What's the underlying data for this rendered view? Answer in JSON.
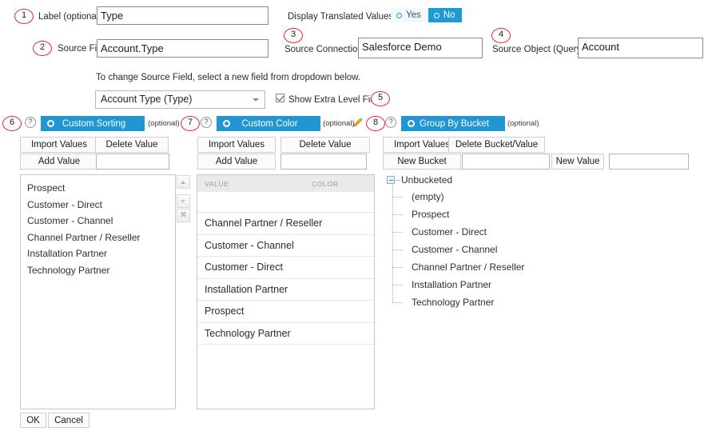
{
  "form": {
    "label_field": {
      "label": "Label (optional):",
      "value": "Type",
      "badge": "1"
    },
    "source_field": {
      "label": "Source Field",
      "value": "Account.Type",
      "badge": "2"
    },
    "source_connection": {
      "label": "Source Connection",
      "value": "Salesforce Demo",
      "badge": "3"
    },
    "source_object": {
      "label": "Source Object (Query)",
      "value": "Account",
      "badge": "4"
    },
    "display_translated": {
      "label": "Display Translated Values:",
      "options": [
        "Yes",
        "No"
      ],
      "selected": "No"
    },
    "hint": "To change Source Field, select a new field from dropdown below.",
    "field_dropdown": {
      "value": "Account Type (Type)"
    },
    "show_extra_level_fields": {
      "label": "Show Extra Level Fields",
      "checked": true,
      "badge": "5"
    }
  },
  "sections": {
    "custom_sorting": {
      "title": "Custom Sorting",
      "optional": "(optional)",
      "badge_left": "6",
      "badge_right": "7",
      "help": "?"
    },
    "custom_color": {
      "title": "Custom Color",
      "optional": "(optional)",
      "badge_right": "8",
      "help": "?"
    },
    "group_by_bucket": {
      "title": "Group By Bucket",
      "optional": "(optional)",
      "help": "?"
    }
  },
  "panel_sorting": {
    "import_values": "Import Values",
    "delete_value": "Delete Value",
    "add_value": "Add Value",
    "add_value_input": "",
    "items": [
      "Prospect",
      "Customer - Direct",
      "Customer - Channel",
      "Channel Partner / Reseller",
      "Installation Partner",
      "Technology Partner"
    ]
  },
  "panel_color": {
    "import_values": "Import Values",
    "delete_value": "Delete Value",
    "add_value": "Add Value",
    "add_value_input": "",
    "columns": [
      "VALUE",
      "COLOR"
    ],
    "rows": [
      {
        "value": "Channel Partner / Reseller",
        "color": ""
      },
      {
        "value": "Customer - Channel",
        "color": ""
      },
      {
        "value": "Customer - Direct",
        "color": ""
      },
      {
        "value": "Installation Partner",
        "color": ""
      },
      {
        "value": "Prospect",
        "color": ""
      },
      {
        "value": "Technology Partner",
        "color": ""
      }
    ]
  },
  "panel_bucket": {
    "import_values": "Import Values",
    "delete_bucket_value": "Delete Bucket/Value",
    "new_bucket": "New Bucket",
    "new_bucket_input": "",
    "new_value": "New Value",
    "new_value_input": "",
    "tree": {
      "root": "Unbucketed",
      "children": [
        "(empty)",
        "Prospect",
        "Customer - Direct",
        "Customer - Channel",
        "Channel Partner / Reseller",
        "Installation Partner",
        "Technology Partner"
      ]
    }
  },
  "footer": {
    "ok": "OK",
    "cancel": "Cancel"
  },
  "colors": {
    "accent": "#2196d3",
    "badge_ring": "#e8262b",
    "pencil": "#f2a31c"
  }
}
